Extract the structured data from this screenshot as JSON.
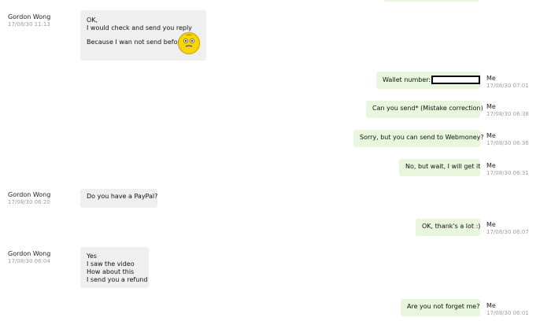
{
  "contact_name": "Gordon Wong",
  "me_label": "Me",
  "messages": [
    {
      "sender": "Gordon Wong",
      "time": "17/08/30 11:13",
      "lines": [
        "OK,",
        "I would check and send you reply",
        "",
        "Because I wan not send before"
      ]
    },
    {
      "sender": "Me",
      "time": "17/08/30 07:01",
      "text": "Wallet number:"
    },
    {
      "sender": "Me",
      "time": "17/08/30 06:38",
      "text": "Can you send* (Mistake correction)"
    },
    {
      "sender": "Me",
      "time": "17/08/30 06:36",
      "text": "Sorry, but you can send to Webmoney?"
    },
    {
      "sender": "Me",
      "time": "17/08/30 06:31",
      "text": "No, but wait, I will get it"
    },
    {
      "sender": "Gordon Wong",
      "time": "17/08/30 06:20",
      "text": "Do you have a PayPal?"
    },
    {
      "sender": "Me",
      "time": "17/08/30 06:07",
      "text": "OK, thank's a lot :)"
    },
    {
      "sender": "Gordon Wong",
      "time": "17/08/30 06:04",
      "lines": [
        "Yes",
        "I saw the video",
        "How about this",
        "I send you a refund"
      ]
    },
    {
      "sender": "Me",
      "time": "17/08/30 06:01",
      "text": "Are you not forget me?"
    }
  ]
}
